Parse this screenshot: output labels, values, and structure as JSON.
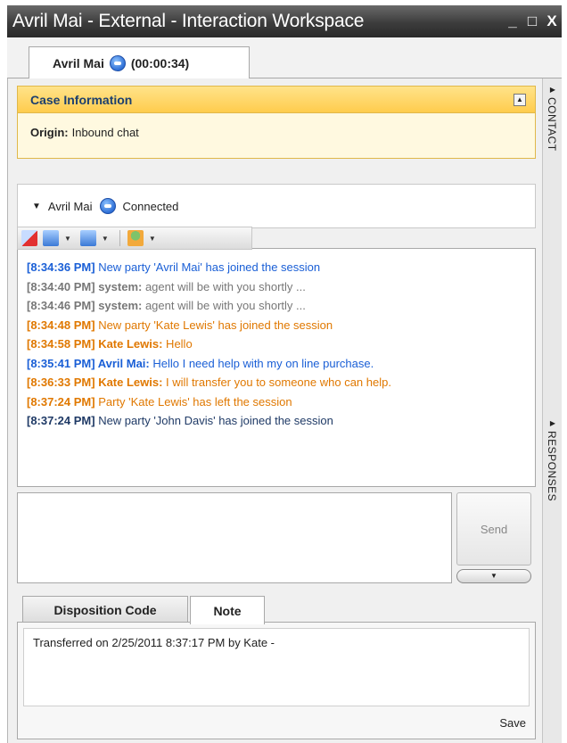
{
  "window": {
    "title": "Avril Mai - External - Interaction Workspace",
    "controls": {
      "minimize": "_",
      "maximize": "□",
      "close": "X"
    }
  },
  "tabs": [
    {
      "label": "Avril Mai",
      "timer": "(00:00:34)",
      "icon": "chat-icon"
    }
  ],
  "case_info": {
    "header": "Case Information",
    "origin_label": "Origin:",
    "origin_value": "Inbound chat"
  },
  "party": {
    "name": "Avril Mai",
    "status": "Connected"
  },
  "toolbar": {
    "icons": [
      "end-chat-icon",
      "transfer-icon",
      "conference-icon",
      "consult-icon"
    ]
  },
  "transcript": [
    {
      "time": "[8:34:36 PM]",
      "who": "",
      "text": " New party 'Avril Mai' has joined the session",
      "color": "#1a5fd6"
    },
    {
      "time": "[8:34:40 PM]",
      "who": " system:",
      "text": " agent will be with you shortly ...",
      "color": "#777777"
    },
    {
      "time": "[8:34:46 PM]",
      "who": " system:",
      "text": " agent will be with you shortly ...",
      "color": "#777777"
    },
    {
      "time": "[8:34:48 PM]",
      "who": "",
      "text": " New party 'Kate Lewis' has joined the session",
      "color": "#e07800"
    },
    {
      "time": "[8:34:58 PM]",
      "who": " Kate Lewis:",
      "text": " Hello",
      "color": "#e07800"
    },
    {
      "time": "[8:35:41 PM]",
      "who": " Avril Mai:",
      "text": " Hello I need help with my on line purchase.",
      "color": "#1a5fd6"
    },
    {
      "time": "[8:36:33 PM]",
      "who": " Kate Lewis:",
      "text": " I will transfer you to someone who can help.",
      "color": "#e07800"
    },
    {
      "time": "[8:37:24 PM]",
      "who": "",
      "text": " Party 'Kate Lewis' has left the session",
      "color": "#e07800"
    },
    {
      "time": "[8:37:24 PM]",
      "who": "",
      "text": " New party 'John Davis' has joined the session",
      "color": "#1f3a66"
    }
  ],
  "composer": {
    "value": "",
    "send_label": "Send"
  },
  "bottom_tabs": [
    {
      "label": "Disposition Code"
    },
    {
      "label": "Note"
    }
  ],
  "note": {
    "text": "Transferred on 2/25/2011 8:37:17 PM by Kate -",
    "save_label": "Save"
  },
  "side_panels": [
    {
      "label": "CONTACT"
    },
    {
      "label": "RESPONSES"
    }
  ]
}
